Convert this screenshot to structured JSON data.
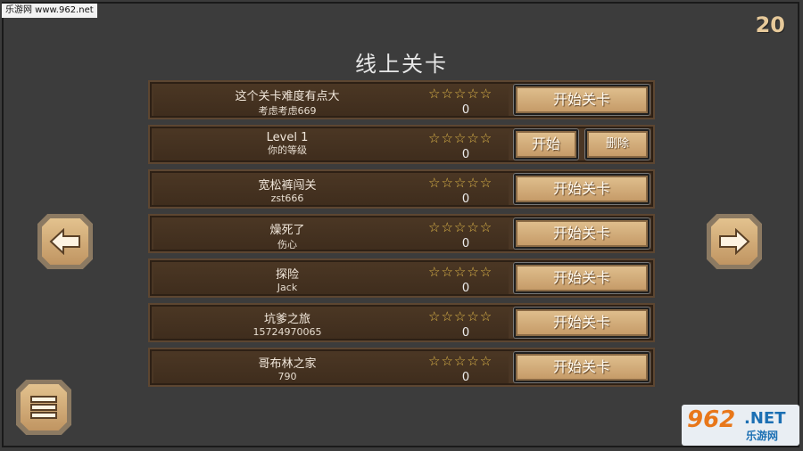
{
  "watermark_top": "乐游网 www.962.net",
  "counter": "20",
  "title": "线上关卡",
  "levels": [
    {
      "name": "这个关卡难度有点大",
      "author": "考虑考虑669",
      "stars": "☆☆☆☆☆",
      "score": "0",
      "buttons": [
        "开始关卡"
      ]
    },
    {
      "name": "Level 1",
      "author": "你的等级",
      "stars": "☆☆☆☆☆",
      "score": "0",
      "buttons": [
        "开始",
        "删除"
      ]
    },
    {
      "name": "宽松裤闯关",
      "author": "zst666",
      "stars": "☆☆☆☆☆",
      "score": "0",
      "buttons": [
        "开始关卡"
      ]
    },
    {
      "name": "燥死了",
      "author": "伤心",
      "stars": "☆☆☆☆☆",
      "score": "0",
      "buttons": [
        "开始关卡"
      ]
    },
    {
      "name": "探险",
      "author": "Jack",
      "stars": "☆☆☆☆☆",
      "score": "0",
      "buttons": [
        "开始关卡"
      ]
    },
    {
      "name": "坑爹之旅",
      "author": "15724970065",
      "stars": "☆☆☆☆☆",
      "score": "0",
      "buttons": [
        "开始关卡"
      ]
    },
    {
      "name": "哥布林之家",
      "author": "790",
      "stars": "☆☆☆☆☆",
      "score": "0",
      "buttons": [
        "开始关卡"
      ]
    }
  ],
  "nav": {
    "left_icon": "arrow-left-icon",
    "right_icon": "arrow-right-icon",
    "menu_icon": "menu-icon"
  },
  "watermark_bottom": {
    "num": "962",
    "net": ".NET",
    "cn": "乐游网"
  },
  "colors": {
    "accent": "#e0c08f",
    "star": "#e0b84a",
    "row_bg": "#4a3624"
  }
}
